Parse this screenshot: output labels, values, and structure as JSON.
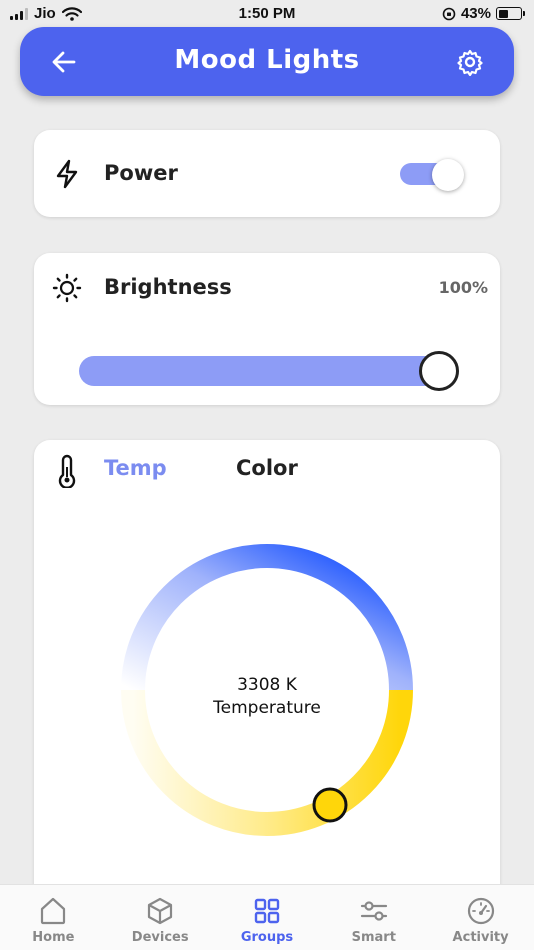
{
  "status_bar": {
    "carrier": "Jio",
    "time": "1:50 PM",
    "battery_percent": "43%"
  },
  "header": {
    "title": "Mood Lights",
    "back_icon": "arrow-left-icon",
    "settings_icon": "gear-icon"
  },
  "power": {
    "label": "Power",
    "icon": "lightning-icon",
    "on": true
  },
  "brightness": {
    "label": "Brightness",
    "icon": "sun-icon",
    "value_text": "100%",
    "value": 1.0
  },
  "temperature": {
    "icon": "thermometer-icon",
    "tabs": [
      {
        "label": "Temp",
        "active": true
      },
      {
        "label": "Color",
        "active": false
      }
    ],
    "value_text": "3308 K",
    "caption": "Temperature"
  },
  "nav": {
    "items": [
      {
        "label": "Home",
        "icon": "home-icon",
        "active": false
      },
      {
        "label": "Devices",
        "icon": "cube-icon",
        "active": false
      },
      {
        "label": "Groups",
        "icon": "grid-icon",
        "active": true
      },
      {
        "label": "Smart",
        "icon": "sliders-icon",
        "active": false
      },
      {
        "label": "Activity",
        "icon": "gauge-icon",
        "active": false
      }
    ]
  },
  "colors": {
    "accent": "#4d63ee",
    "accent_light": "#8d9cf6",
    "warm": "#ffd60a",
    "cool": "#0040ff"
  }
}
